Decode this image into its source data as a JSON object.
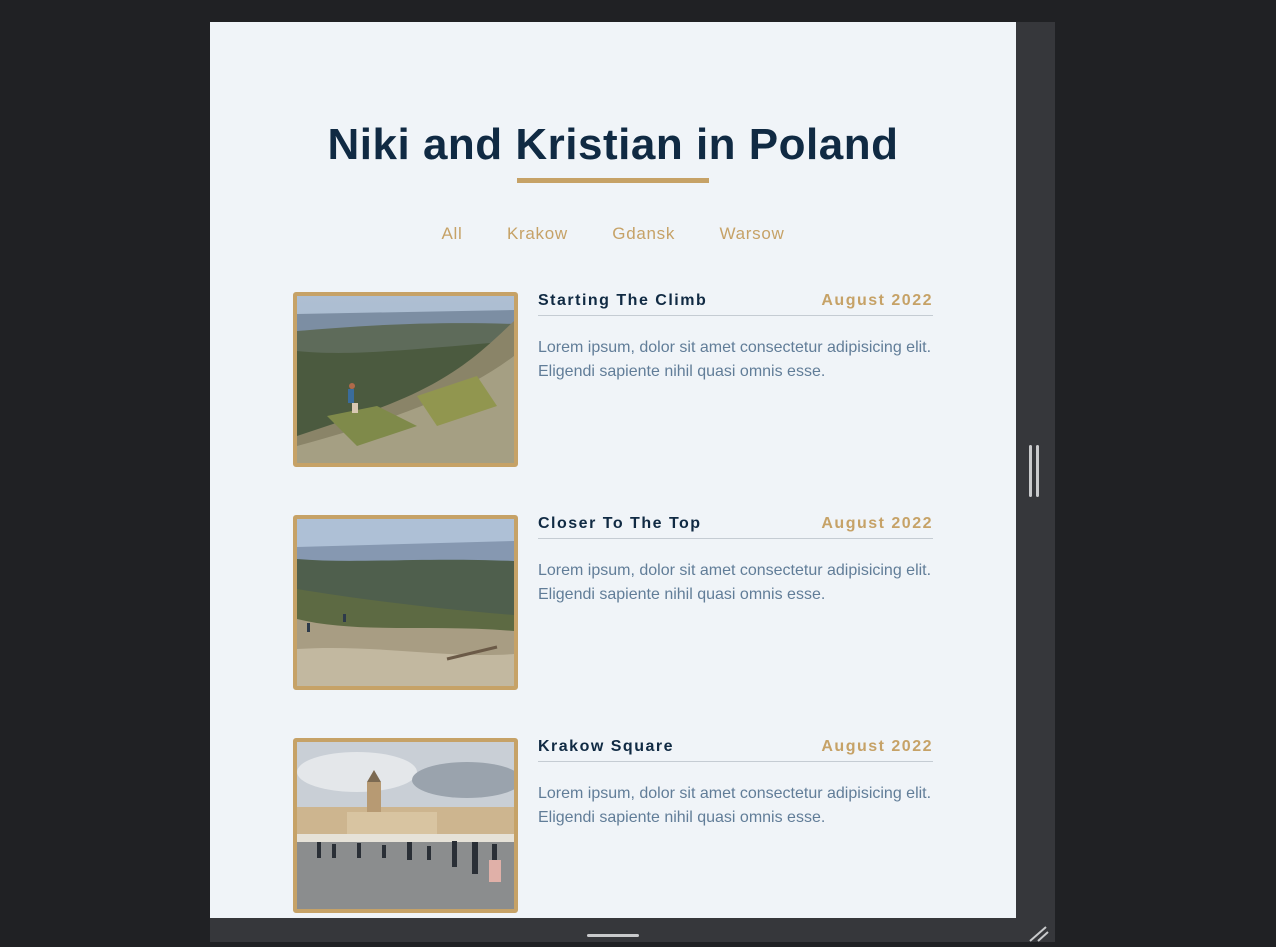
{
  "page": {
    "title": "Niki and Kristian in Poland",
    "tabs": [
      {
        "label": "All"
      },
      {
        "label": "Krakow"
      },
      {
        "label": "Gdansk"
      },
      {
        "label": "Warsow"
      }
    ]
  },
  "items": [
    {
      "title": "Starting The Climb",
      "date": "August 2022",
      "text": "Lorem ipsum, dolor sit amet consectetur adipisicing elit. Eligendi sapiente nihil quasi omnis esse."
    },
    {
      "title": "Closer To The Top",
      "date": "August 2022",
      "text": "Lorem ipsum, dolor sit amet consectetur adipisicing elit. Eligendi sapiente nihil quasi omnis esse."
    },
    {
      "title": "Krakow Square",
      "date": "August 2022",
      "text": "Lorem ipsum, dolor sit amet consectetur adipisicing elit. Eligendi sapiente nihil quasi omnis esse."
    }
  ],
  "colors": {
    "accent": "#c6a267",
    "heading": "#102a43",
    "body_text": "#617d98",
    "background": "#f0f4f8"
  },
  "icons": {
    "handle": "drag-handle-icon",
    "resize": "resize-corner-icon"
  }
}
